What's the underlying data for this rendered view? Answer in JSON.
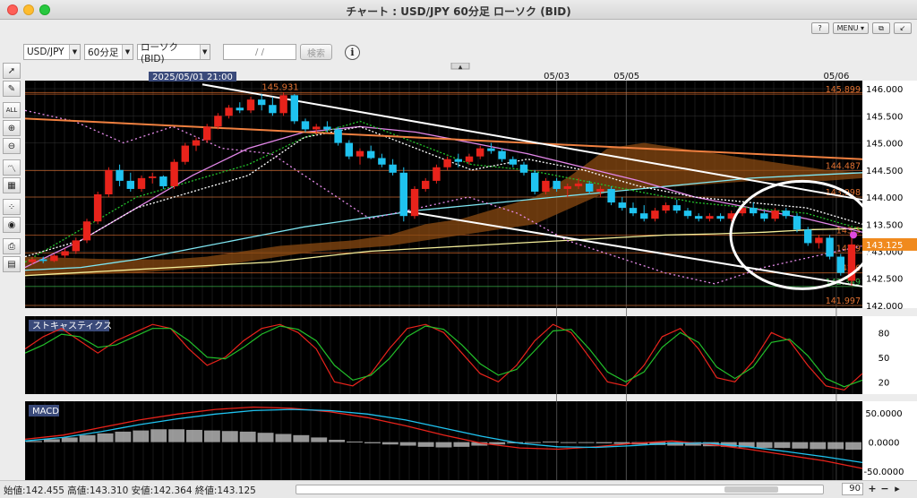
{
  "window": {
    "title": "チャート : USD/JPY 60分足 ローソク (BID)"
  },
  "topbar": {
    "help": "?",
    "menu": "MENU ▾",
    "copy": "⧉",
    "detach": "↙"
  },
  "toolbar": {
    "symbol": "USD/JPY",
    "timeframe": "60分足",
    "chart_type": "ローソク(BID)",
    "date_placeholder": "/     /",
    "search": "検索",
    "info": "i"
  },
  "side_tools": [
    "cursor-icon",
    "pen-icon",
    "all-delete-icon",
    "zoom-in-icon",
    "zoom-out-icon",
    "line-chart-icon",
    "table-icon",
    "dots-icon",
    "eye-icon",
    "print-icon",
    "settings-icon"
  ],
  "status": {
    "text": "始値:142.455  高値:143.310  安値:142.364  終値:143.125",
    "zoom": "90"
  },
  "colors": {
    "bg": "#000000",
    "up": "#e8231b",
    "down": "#1fc3f0",
    "grid": "#2b2b2b"
  },
  "chart_data": [
    {
      "type": "line",
      "name": "price",
      "series_kind": "candlestick",
      "cursor_label": "2025/05/01 21:00",
      "date_labels": [
        {
          "label": "05/03",
          "i": 15
        },
        {
          "label": "05/05",
          "i": 17
        },
        {
          "label": "05/06",
          "i": 23
        }
      ],
      "yticks": [
        "146.000",
        "145.500",
        "145.000",
        "144.500",
        "144.000",
        "143.500",
        "143.000",
        "142.500",
        "142.000"
      ],
      "ylim": [
        141.95,
        146.15
      ],
      "price_tags": [
        {
          "label": "145.931",
          "value": 145.93,
          "color": "#e07030",
          "side": "left"
        },
        {
          "label": "145.899",
          "value": 145.9,
          "color": "#e07030",
          "side": "right"
        },
        {
          "label": "144.487",
          "value": 144.49,
          "color": "#e07030",
          "side": "right"
        },
        {
          "label": "143.998",
          "value": 144.0,
          "color": "#e07030",
          "side": "right"
        },
        {
          "label": "143.3",
          "value": 143.3,
          "color": "#e07030",
          "side": "right"
        },
        {
          "label": "142.9",
          "value": 142.97,
          "color": "#e07030",
          "side": "right"
        },
        {
          "label": "142.6",
          "value": 142.6,
          "color": "#e07030",
          "side": "right"
        },
        {
          "label": "142.349",
          "value": 142.35,
          "color": "#3ab34a",
          "side": "right"
        },
        {
          "label": "141.997",
          "value": 142.0,
          "color": "#e07030",
          "side": "right"
        }
      ],
      "current_price": "143.125",
      "candles": [
        [
          142.8,
          142.9,
          142.75,
          142.85
        ],
        [
          142.85,
          142.9,
          142.78,
          142.82
        ],
        [
          142.82,
          142.95,
          142.8,
          142.92
        ],
        [
          142.92,
          143.05,
          142.88,
          143.0
        ],
        [
          143.0,
          143.25,
          142.95,
          143.2
        ],
        [
          143.2,
          143.6,
          143.15,
          143.55
        ],
        [
          143.55,
          144.1,
          143.5,
          144.05
        ],
        [
          144.05,
          144.55,
          144.0,
          144.5
        ],
        [
          144.5,
          144.6,
          144.2,
          144.3
        ],
        [
          144.3,
          144.45,
          144.1,
          144.15
        ],
        [
          144.15,
          144.4,
          144.1,
          144.35
        ],
        [
          144.35,
          144.45,
          144.25,
          144.38
        ],
        [
          144.38,
          144.4,
          144.15,
          144.2
        ],
        [
          144.2,
          144.7,
          144.15,
          144.65
        ],
        [
          144.65,
          145.0,
          144.6,
          144.95
        ],
        [
          144.95,
          145.1,
          144.85,
          145.05
        ],
        [
          145.05,
          145.35,
          145.0,
          145.3
        ],
        [
          145.3,
          145.55,
          145.25,
          145.5
        ],
        [
          145.5,
          145.7,
          145.45,
          145.65
        ],
        [
          145.65,
          145.75,
          145.55,
          145.6
        ],
        [
          145.6,
          145.85,
          145.55,
          145.8
        ],
        [
          145.8,
          145.9,
          145.6,
          145.7
        ],
        [
          145.7,
          145.85,
          145.5,
          145.55
        ],
        [
          145.55,
          145.93,
          145.5,
          145.88
        ],
        [
          145.88,
          145.9,
          145.35,
          145.4
        ],
        [
          145.4,
          145.45,
          145.2,
          145.25
        ],
        [
          145.25,
          145.35,
          145.15,
          145.3
        ],
        [
          145.3,
          145.4,
          145.2,
          145.25
        ],
        [
          145.25,
          145.3,
          144.95,
          145.0
        ],
        [
          145.0,
          145.05,
          144.7,
          144.75
        ],
        [
          144.75,
          144.9,
          144.6,
          144.85
        ],
        [
          144.85,
          144.95,
          144.7,
          144.72
        ],
        [
          144.72,
          144.8,
          144.55,
          144.6
        ],
        [
          144.6,
          144.7,
          144.4,
          144.45
        ],
        [
          144.45,
          144.55,
          143.55,
          143.65
        ],
        [
          143.65,
          144.2,
          143.6,
          144.15
        ],
        [
          144.15,
          144.35,
          144.1,
          144.3
        ],
        [
          144.3,
          144.6,
          144.25,
          144.55
        ],
        [
          144.55,
          144.75,
          144.5,
          144.7
        ],
        [
          144.7,
          144.8,
          144.55,
          144.65
        ],
        [
          144.65,
          144.8,
          144.6,
          144.75
        ],
        [
          144.75,
          144.95,
          144.7,
          144.9
        ],
        [
          144.9,
          145.0,
          144.8,
          144.85
        ],
        [
          144.85,
          144.9,
          144.65,
          144.7
        ],
        [
          144.7,
          144.75,
          144.55,
          144.6
        ],
        [
          144.6,
          144.65,
          144.4,
          144.45
        ],
        [
          144.45,
          144.5,
          144.05,
          144.1
        ],
        [
          144.1,
          144.35,
          144.05,
          144.3
        ],
        [
          144.3,
          144.35,
          144.1,
          144.15
        ],
        [
          144.15,
          144.25,
          144.0,
          144.2
        ],
        [
          144.2,
          144.35,
          144.15,
          144.25
        ],
        [
          144.25,
          144.3,
          144.05,
          144.1
        ],
        [
          144.1,
          144.2,
          144.0,
          144.15
        ],
        [
          144.15,
          144.2,
          143.85,
          143.9
        ],
        [
          143.9,
          144.0,
          143.75,
          143.8
        ],
        [
          143.8,
          143.9,
          143.65,
          143.7
        ],
        [
          143.7,
          143.85,
          143.55,
          143.6
        ],
        [
          143.6,
          143.8,
          143.55,
          143.75
        ],
        [
          143.75,
          143.9,
          143.7,
          143.85
        ],
        [
          143.85,
          143.95,
          143.7,
          143.75
        ],
        [
          143.75,
          143.8,
          143.6,
          143.65
        ],
        [
          143.65,
          143.7,
          143.55,
          143.6
        ],
        [
          143.6,
          143.7,
          143.55,
          143.65
        ],
        [
          143.65,
          143.7,
          143.55,
          143.6
        ],
        [
          143.6,
          143.75,
          143.55,
          143.7
        ],
        [
          143.7,
          143.85,
          143.65,
          143.8
        ],
        [
          143.8,
          143.9,
          143.65,
          143.7
        ],
        [
          143.7,
          143.75,
          143.55,
          143.6
        ],
        [
          143.6,
          143.8,
          143.55,
          143.75
        ],
        [
          143.75,
          143.8,
          143.6,
          143.65
        ],
        [
          143.65,
          143.7,
          143.35,
          143.4
        ],
        [
          143.4,
          143.45,
          143.1,
          143.15
        ],
        [
          143.15,
          143.3,
          143.05,
          143.25
        ],
        [
          143.25,
          143.3,
          142.85,
          142.9
        ],
        [
          142.9,
          142.95,
          142.55,
          142.6
        ],
        [
          142.455,
          143.31,
          142.364,
          143.125
        ]
      ]
    },
    {
      "type": "line",
      "name": "stochastics",
      "label": "ストキャスティクス",
      "yticks": [
        "80",
        "50",
        "20"
      ],
      "ylim": [
        5,
        100
      ]
    },
    {
      "type": "line",
      "name": "macd",
      "label": "MACD",
      "yticks": [
        "50.0000",
        "0.0000",
        "-50.0000"
      ],
      "ylim": [
        -65,
        70
      ]
    }
  ]
}
